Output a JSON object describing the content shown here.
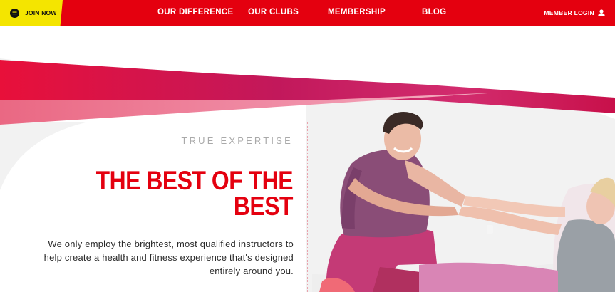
{
  "nav": {
    "join_label": "JOIN NOW",
    "links": [
      "OUR DIFFERENCE",
      "OUR CLUBS",
      "MEMBERSHIP",
      "BLOG"
    ],
    "login_label": "MEMBER LOGIN"
  },
  "hero": {
    "eyebrow": "TRUE EXPERTISE",
    "headline_line1": "THE BEST OF THE",
    "headline_line2": "BEST",
    "body_line1": "We only employ the brightest, most qualified instructors to",
    "body_line2": "help create a health and fitness experience that's designed",
    "body_line3": "entirely around you."
  },
  "colors": {
    "brand_red": "#e4000f",
    "brand_yellow": "#f4e500",
    "band_magenta": "#c2185b",
    "band_pink": "#ec6a88"
  },
  "icons": {
    "join": "chat-bubble-icon",
    "login": "user-icon"
  }
}
